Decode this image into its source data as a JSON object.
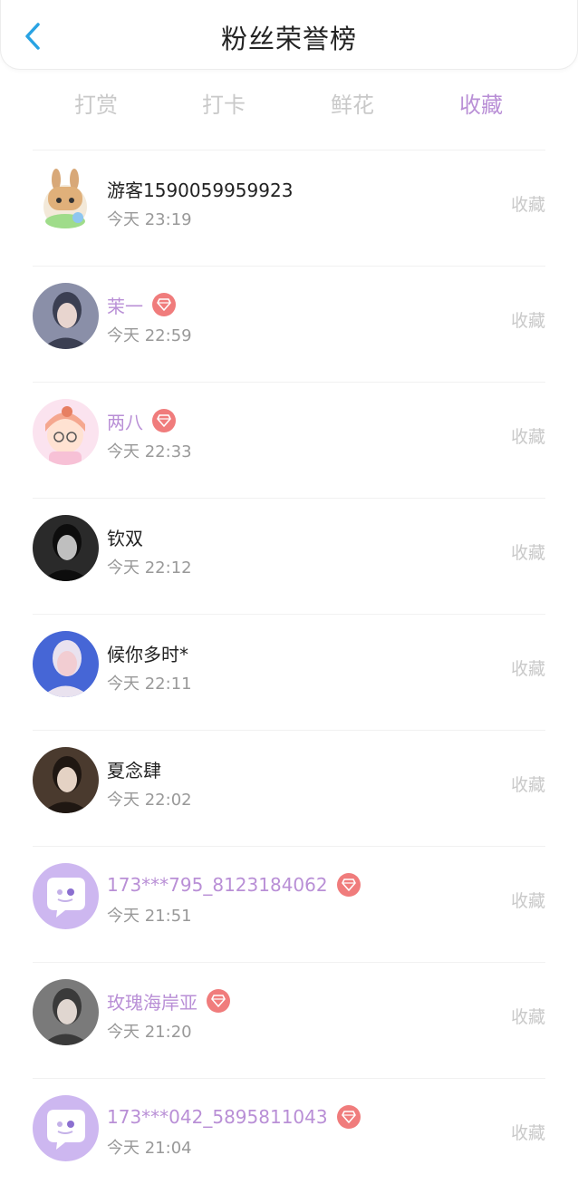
{
  "header": {
    "title": "粉丝荣誉榜",
    "back_icon": "chevron-left-icon"
  },
  "tabs": [
    {
      "label": "打赏",
      "active": false
    },
    {
      "label": "打卡",
      "active": false
    },
    {
      "label": "鲜花",
      "active": false
    },
    {
      "label": "收藏",
      "active": true
    }
  ],
  "colors": {
    "accent": "#b98fd6",
    "badge": "#f07c7c",
    "back": "#29a3e3"
  },
  "fans": [
    {
      "name": "游客1590059959923",
      "time": "今天 23:19",
      "vip": false,
      "action": "收藏",
      "avatar": "cartoon-bunny-avatar"
    },
    {
      "name": "茉一",
      "time": "今天 22:59",
      "vip": true,
      "action": "收藏",
      "avatar": "photo-avatar"
    },
    {
      "name": "两八",
      "time": "今天 22:33",
      "vip": true,
      "action": "收藏",
      "avatar": "cartoon-girl-avatar"
    },
    {
      "name": "钦双",
      "time": "今天 22:12",
      "vip": false,
      "action": "收藏",
      "avatar": "photo-avatar"
    },
    {
      "name": "候你多时*",
      "time": "今天 22:11",
      "vip": false,
      "action": "收藏",
      "avatar": "photo-avatar"
    },
    {
      "name": "夏念肆",
      "time": "今天 22:02",
      "vip": false,
      "action": "收藏",
      "avatar": "photo-avatar"
    },
    {
      "name": "173***795_8123184062",
      "time": "今天 21:51",
      "vip": true,
      "action": "收藏",
      "avatar": "chat-bubble-default-avatar"
    },
    {
      "name": "玫瑰海岸亚",
      "time": "今天 21:20",
      "vip": true,
      "action": "收藏",
      "avatar": "photo-avatar"
    },
    {
      "name": "173***042_5895811043",
      "time": "今天 21:04",
      "vip": true,
      "action": "收藏",
      "avatar": "chat-bubble-default-avatar"
    }
  ]
}
